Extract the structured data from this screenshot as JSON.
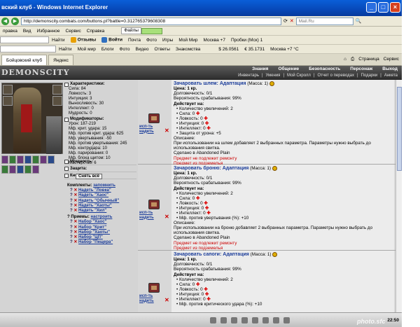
{
  "browser": {
    "title": "вский клуб - Windows Internet Explorer",
    "url": "http://demonscity.combats.com/buttons.pl?battle=0.312765379608308",
    "search_placeholder": "Mail.Ru",
    "menu": [
      "правка",
      "Вид",
      "Избранное",
      "Сервис",
      "Справка"
    ],
    "toolbar1": [
      "Найти",
      "Отзывы",
      "Войти",
      "Почта",
      "Фото",
      "Игры",
      "Мой Мир"
    ],
    "toolbar1_drop": "Файлы",
    "toolbar2": [
      "Найти",
      "Мой мир",
      "Блоги",
      "Фото",
      "Видео",
      "Ответы",
      "Знакомства"
    ],
    "toolbar2_right": [
      "$ 26.0561",
      "€ 35.1731",
      "Москва +7 °C",
      "Пробки (Мск) 1"
    ],
    "weather": "Москва +7",
    "tabs": [
      "Бойцовский клуб",
      "Яндекс"
    ],
    "tab_tools": [
      "Страница",
      "Сервис"
    ]
  },
  "game": {
    "logo": "DEMONSCITY",
    "nav": [
      "Знания",
      "Общение",
      "Безопасность",
      "Персонаж",
      "Выход"
    ],
    "subnav": [
      "Инвентарь",
      "Умения",
      "Мой Скролл",
      "Отчет о переводах",
      "Подарки",
      "Анкета"
    ]
  },
  "stats": {
    "characteristics_label": "Характеристики:",
    "characteristics": [
      "Сила: 84",
      "Ловкость: 3",
      "Интуиция: 3",
      "Выносливость: 30",
      "Интеллект: 0",
      "Мудрость: 0"
    ],
    "modifiers_label": "Модификаторы:",
    "modifiers": [
      "Урон: 187-219",
      "Мф. крит. удара: 15",
      "Мф. против крит. удара: 625",
      "Мф. увертывания: -50",
      "Мф. против увертывания: 245",
      "Мф. контрудара: 10",
      "Мф. парирования: 0",
      "Мф. блока щитом: 10",
      "Мастерство: 6"
    ],
    "power_label": "Мощность:",
    "defense_label": "Защита:",
    "buttons_label": "Кнопки:",
    "remove_all": "Снять всё",
    "sets_label": "Комплекты:",
    "sets_remember": "запомнить",
    "sets": [
      "Надеть \"Ловка\"",
      "Надеть \"Хаос\"",
      "Надеть \"Обычный\"",
      "Надеть \"Хаоты\"",
      "Надеть \"Хил\""
    ],
    "tricks_label": "Приемы:",
    "tricks_configure": "настроить",
    "tricks": [
      "Набор \"Хаос\"",
      "Набор \"Крит\"",
      "Набор \"Хаоты\"",
      "Набор \"ЦП\"",
      "Набор \"Пещера\""
    ]
  },
  "items": [
    {
      "use": "исп-ть",
      "wear": "надеть",
      "name": "Зачаровать шлем: Адаптация",
      "mass": "(Масса: 1)",
      "price": "Цена: 1 кр.",
      "durability": "Долговечность: 0/1",
      "chance": "Вероятность срабатывания: 99%",
      "acts_label": "Действует на:",
      "effects": [
        "• Количество увеличений: 2",
        "• Сила: 0",
        "• Ловкость: 0",
        "• Интуиция: 0",
        "• Интеллект: 0",
        "• Защита от урона: +5"
      ],
      "desc_label": "Описание:",
      "desc": "При использовании на шлем добавляет 2 выбранных параметра. Параметры нужно выбрать до использования свитка.",
      "made": "Сделано в Abandoned Plain",
      "warn1": "Предмет не подлежит ремонту",
      "warn2": "Предмет из подземелья"
    },
    {
      "use": "исп-ть",
      "wear": "надеть",
      "name": "Зачаровать броню: Адаптация",
      "mass": "(Масса: 1)",
      "price": "Цена: 1 кр.",
      "durability": "Долговечность: 0/1",
      "chance": "Вероятность срабатывания: 99%",
      "acts_label": "Действует на:",
      "effects": [
        "• Количество увеличений: 2",
        "• Сила: 0",
        "• Ловкость: 0",
        "• Интуиция: 0",
        "• Интеллект: 0",
        "• Мф. против увертывания (%): +10"
      ],
      "desc_label": "Описание:",
      "desc": "При использовании на броню добавляет 2 выбранных параметра. Параметры нужно выбрать до использования свитка.",
      "made": "Сделано в Abandoned Plain",
      "warn1": "Предмет не подлежит ремонту",
      "warn2": "Предмет из подземелья"
    },
    {
      "use": "исп-ть",
      "wear": "надеть",
      "name": "Зачаровать сапоги: Адаптация",
      "mass": "(Масса: 1)",
      "price": "Цена: 1 кр.",
      "durability": "Долговечность: 0/1",
      "chance": "Вероятность срабатывания: 99%",
      "acts_label": "Действует на:",
      "effects": [
        "• Количество увеличений: 2",
        "• Сила: 0",
        "• Ловкость: 0",
        "• Интуиция: 0",
        "• Интеллект: 0",
        "• Мф. против критического удара (%): +10"
      ]
    }
  ],
  "taskbar": {
    "clock": "22:50"
  },
  "watermark": "photo.sfc"
}
